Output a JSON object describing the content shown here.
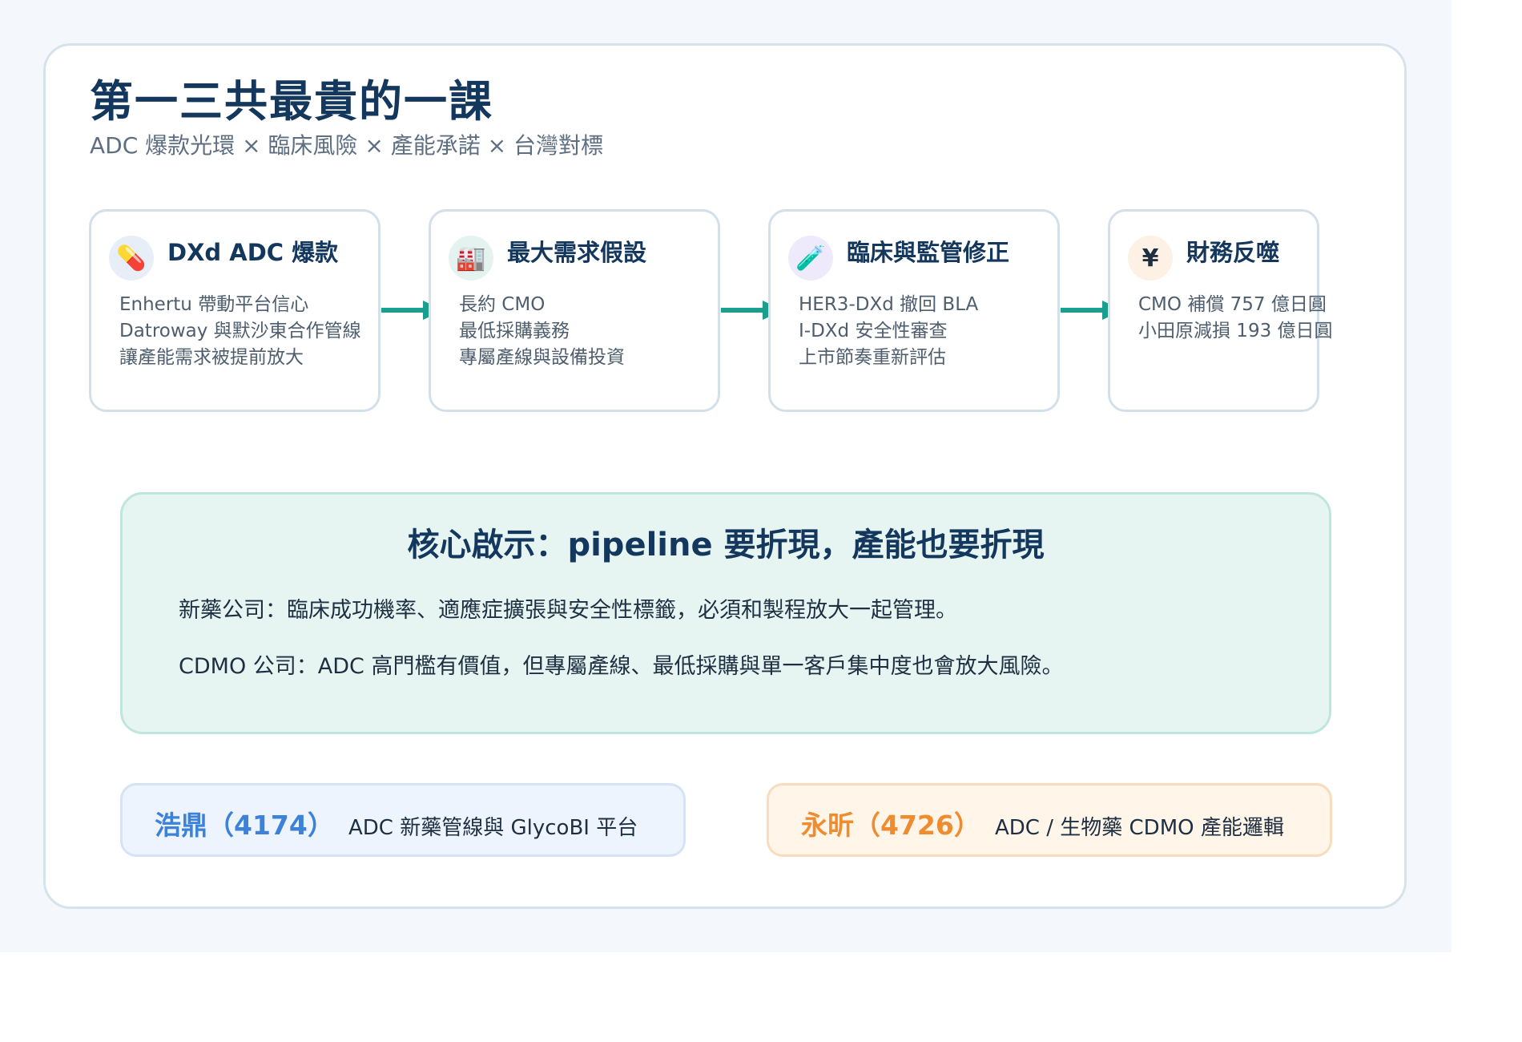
{
  "header": {
    "title": "第一三共最貴的一課",
    "subtitle": "ADC 爆款光環 × 臨床風險 × 產能承諾 × 台灣對標"
  },
  "flow": {
    "arrow_color": "#1a9e8e",
    "steps": [
      {
        "icon": "pill-icon",
        "glyph": "💊",
        "title": "DXd ADC 爆款",
        "lines": [
          "Enhertu 帶動平台信心",
          "Datroway 與默沙東合作管線",
          "讓產能需求被提前放大"
        ]
      },
      {
        "icon": "factory-icon",
        "glyph": "🏭",
        "title": "最大需求假設",
        "lines": [
          "長約 CMO",
          "最低採購義務",
          "專屬產線與設備投資"
        ]
      },
      {
        "icon": "test-tube-icon",
        "glyph": "🧪",
        "title": "臨床與監管修正",
        "lines": [
          "HER3-DXd 撤回 BLA",
          "I-DXd 安全性審查",
          "上市節奏重新評估"
        ]
      },
      {
        "icon": "yen-icon",
        "glyph": "¥",
        "title": "財務反噬",
        "lines": [
          "CMO 補償 757 億日圓",
          "小田原減損 193 億日圓"
        ]
      }
    ]
  },
  "insight": {
    "title": "核心啟示：pipeline 要折現，產能也要折現",
    "line1": "新藥公司：臨床成功機率、適應症擴張與安全性標籤，必須和製程放大一起管理。",
    "line2": "CDMO 公司：ADC 高門檻有價值，但專屬產線、最低採購與單一客戶集中度也會放大風險。"
  },
  "companies": [
    {
      "name": "浩鼎（4174）",
      "desc": "ADC 新藥管線與 GlycoBI 平台",
      "accent": "#3b82d8",
      "bg": "#eef4fd",
      "border": "#d4e3f6"
    },
    {
      "name": "永昕（4726）",
      "desc": "ADC / 生物藥 CDMO 產能邏輯",
      "accent": "#ef8c2f",
      "bg": "#fff5e9",
      "border": "#f8dcbd"
    }
  ]
}
